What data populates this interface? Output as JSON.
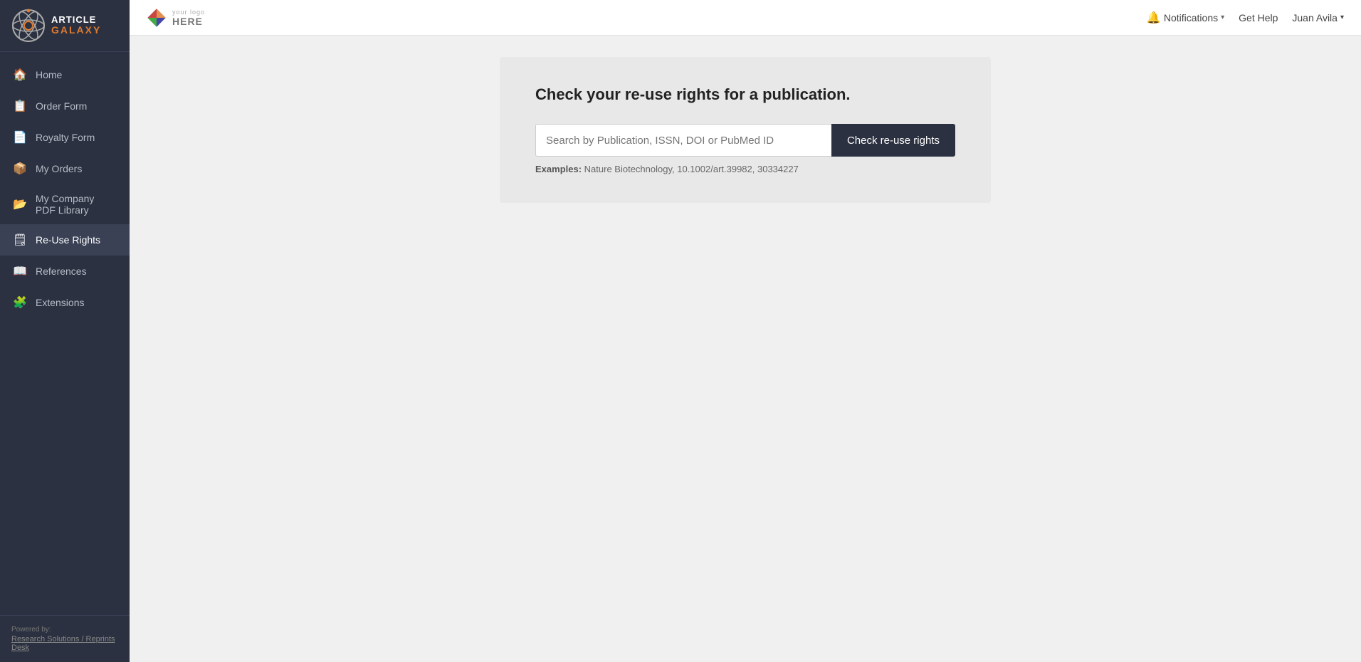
{
  "sidebar": {
    "logo": {
      "article": "ARTICLE",
      "galaxy": "GALAXY"
    },
    "items": [
      {
        "id": "home",
        "label": "Home",
        "icon": "🏠",
        "active": false
      },
      {
        "id": "order-form",
        "label": "Order Form",
        "icon": "📋",
        "active": false
      },
      {
        "id": "royalty-form",
        "label": "Royalty Form",
        "icon": "📄",
        "active": false
      },
      {
        "id": "my-orders",
        "label": "My Orders",
        "icon": "📦",
        "active": false
      },
      {
        "id": "my-company-pdf-library",
        "label": "My Company PDF Library",
        "icon": "📂",
        "active": false
      },
      {
        "id": "re-use-rights",
        "label": "Re-Use Rights",
        "icon": "🗒",
        "active": true
      },
      {
        "id": "references",
        "label": "References",
        "icon": "📖",
        "active": false
      },
      {
        "id": "extensions",
        "label": "Extensions",
        "icon": "🧩",
        "active": false
      }
    ],
    "footer": {
      "powered_by": "Powered by:",
      "company": "Research Solutions / Reprints Desk"
    }
  },
  "topbar": {
    "logo": {
      "your_logo": "your logo",
      "here": "HERE"
    },
    "notifications_label": "Notifications",
    "get_help_label": "Get Help",
    "user_label": "Juan Avila"
  },
  "main": {
    "card": {
      "title": "Check your re-use rights for a publication.",
      "search_placeholder": "Search by Publication, ISSN, DOI or PubMed ID",
      "button_label": "Check re-use rights",
      "examples_label": "Examples:",
      "examples_value": "Nature Biotechnology, 10.1002/art.39982, 30334227"
    }
  }
}
